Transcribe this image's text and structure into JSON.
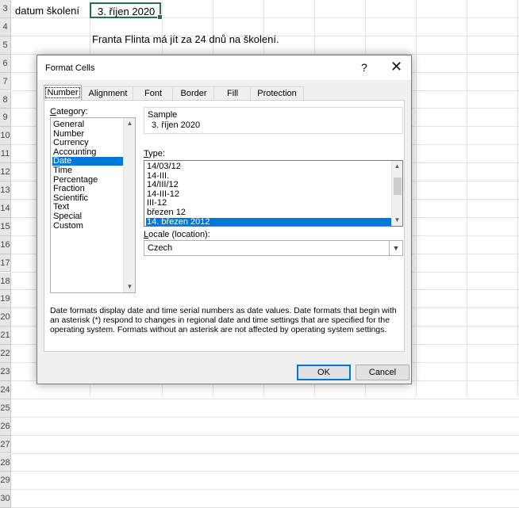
{
  "sheet": {
    "row_numbers": [
      "3",
      "4",
      "5",
      "6",
      "7",
      "8",
      "9",
      "10",
      "11",
      "12",
      "13",
      "14",
      "15",
      "16",
      "17",
      "18",
      "19",
      "20",
      "21",
      "22",
      "23",
      "24",
      "25",
      "26",
      "27",
      "28",
      "29",
      "30"
    ],
    "a3": "datum školení",
    "b3": "3. říjen 2020",
    "b5": "Franta Flinta má jít za 24 dnů na školení."
  },
  "dialog": {
    "title": "Format Cells",
    "help": "?",
    "close": "✕",
    "tabs": [
      "Number",
      "Alignment",
      "Font",
      "Border",
      "Fill",
      "Protection"
    ],
    "category_label": "Category:",
    "categories": [
      "General",
      "Number",
      "Currency",
      "Accounting",
      "Date",
      "Time",
      "Percentage",
      "Fraction",
      "Scientific",
      "Text",
      "Special",
      "Custom"
    ],
    "selected_category": "Date",
    "sample_label": "Sample",
    "sample_value": "3. říjen 2020",
    "type_label": "Type:",
    "types": [
      "14/03/12",
      "14-III.",
      "14/III/12",
      "14-III-12",
      "III-12",
      "březen 12",
      "14. březen 2012"
    ],
    "selected_type": "14. březen 2012",
    "locale_label": "Locale (location):",
    "locale_value": "Czech",
    "description": "Date formats display date and time serial numbers as date values.  Date formats that begin with an asterisk (*) respond to changes in regional date and time settings that are specified for the operating system. Formats without an asterisk are not affected by operating system settings.",
    "ok": "OK",
    "cancel": "Cancel"
  }
}
